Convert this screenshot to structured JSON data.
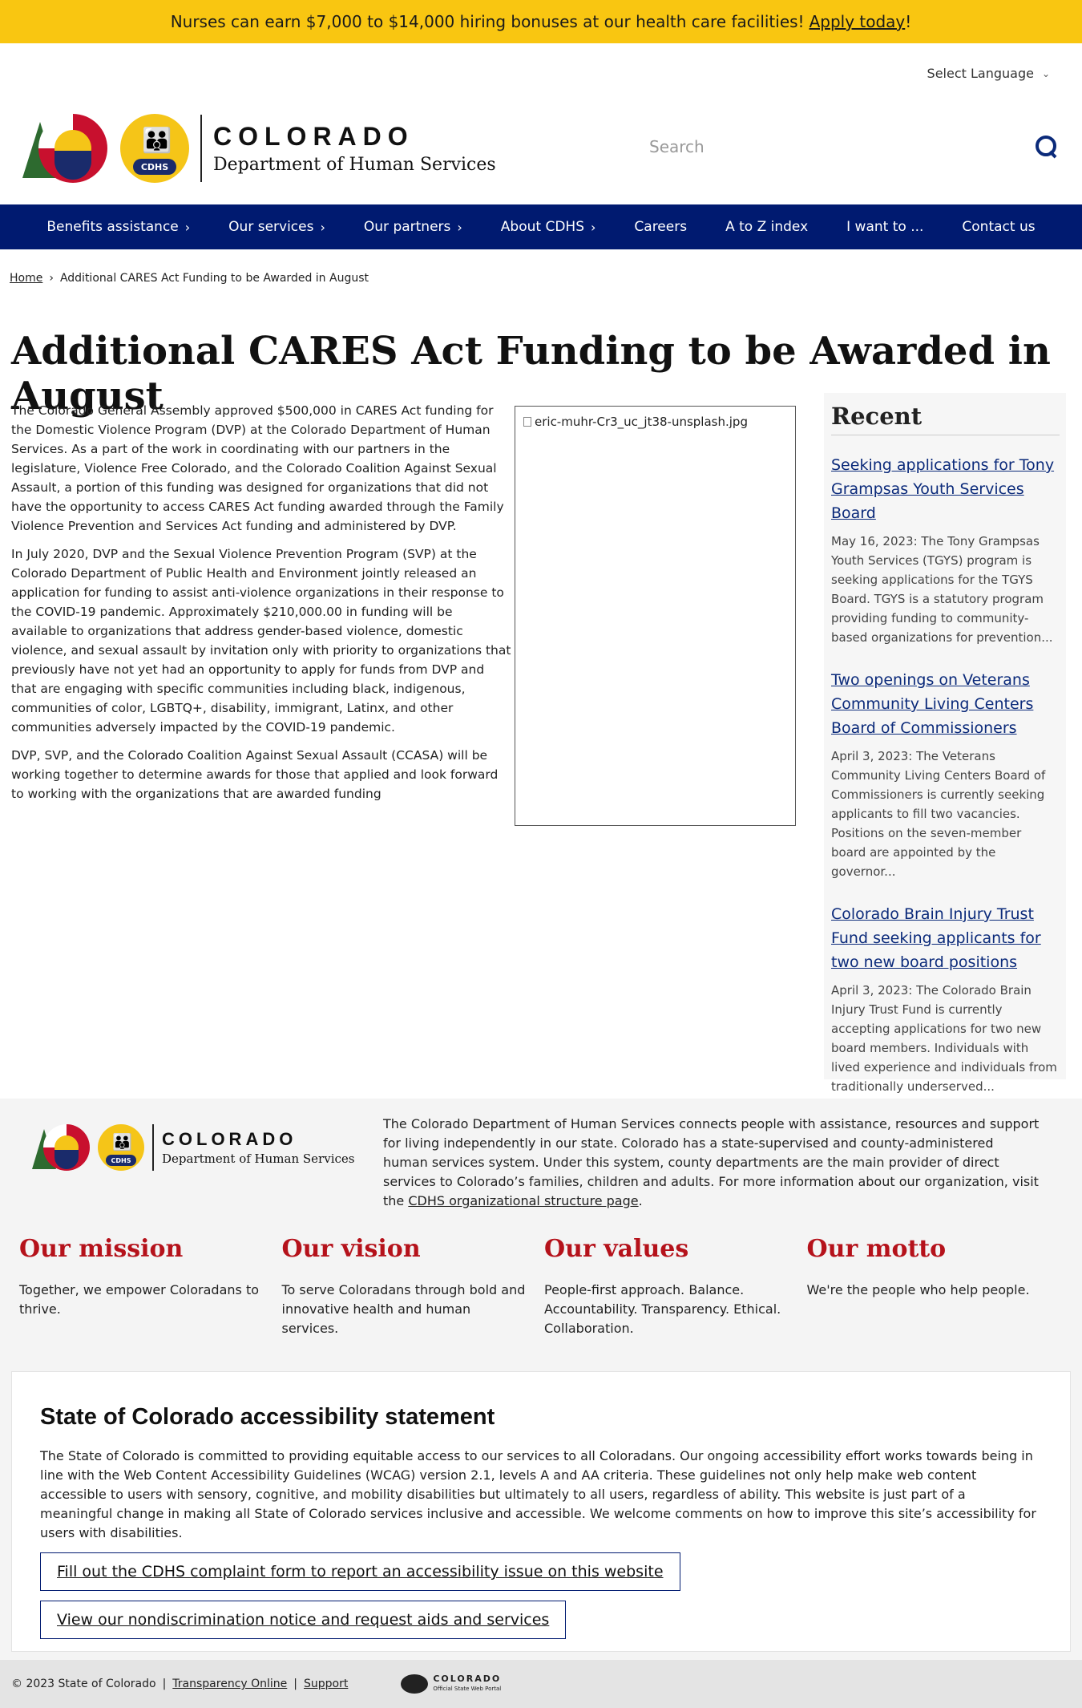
{
  "alert": {
    "text": "Nurses can earn $7,000 to $14,000 hiring bonuses at our health care facilities!",
    "link": "Apply today",
    "suffix": "!"
  },
  "language": {
    "label": "Select Language"
  },
  "logo": {
    "state": "COLORADO",
    "dept": "Department of Human Services",
    "badge": "CDHS"
  },
  "search": {
    "placeholder": "Search"
  },
  "nav": {
    "items": [
      {
        "label": "Benefits assistance",
        "has_menu": true
      },
      {
        "label": "Our services",
        "has_menu": true
      },
      {
        "label": "Our partners",
        "has_menu": true
      },
      {
        "label": "About CDHS",
        "has_menu": true
      },
      {
        "label": "Careers",
        "has_menu": false
      },
      {
        "label": "A to Z index",
        "has_menu": false
      },
      {
        "label": "I want to ...",
        "has_menu": false
      },
      {
        "label": "Contact us",
        "has_menu": false
      }
    ]
  },
  "breadcrumb": {
    "home": "Home",
    "sep": "›",
    "current": "Additional CARES Act Funding to be Awarded in August"
  },
  "page": {
    "title": "Additional CARES Act Funding to be Awarded in August",
    "paragraphs": [
      "The Colorado General Assembly approved $500,000 in CARES Act funding for the Domestic Violence Program (DVP) at the Colorado Department of Human Services. As a part of the work in coordinating with our partners in the legislature, Violence Free Colorado, and the Colorado Coalition Against Sexual Assault, a portion of this funding was designed for organizations that did not have the opportunity to access CARES Act funding awarded through the Family Violence Prevention and Services Act funding and administered by DVP.",
      "In July 2020, DVP and the Sexual Violence Prevention Program (SVP) at the Colorado Department of Public Health and Environment jointly released an application for funding to assist anti-violence organizations in their response to the COVID-19 pandemic. Approximately $210,000.00 in funding will be available to organizations that address gender-based violence, domestic violence, and sexual assault by invitation only with priority to organizations that previously have not yet had an opportunity to apply for funds from DVP and that are engaging with specific communities including black, indigenous, communities of color, LGBTQ+, disability, immigrant, Latinx, and other communities adversely impacted by the COVID-19 pandemic.",
      "DVP, SVP, and the Colorado Coalition Against Sexual Assault (CCASA) will be working together to determine awards for those that applied and look forward to working with the organizations that are awarded funding"
    ],
    "image_alt": "eric-muhr-Cr3_uc_jt38-unsplash.jpg"
  },
  "recent": {
    "heading": "Recent",
    "posts": [
      {
        "title": "Seeking applications for Tony Grampsas Youth Services Board",
        "snippet": "May 16, 2023: The Tony Grampsas Youth Services (TGYS) program is seeking applications for the TGYS Board. TGYS is a statutory program providing funding to community-based organizations for prevention..."
      },
      {
        "title": "Two openings on Veterans Community Living Centers Board of  Commissioners ",
        "snippet": "April 3, 2023: The Veterans Community Living Centers Board of Commissioners is currently seeking applicants to fill two vacancies. Positions on the seven-member board are appointed by the governor..."
      },
      {
        "title": "Colorado Brain Injury Trust Fund seeking applicants for two new board positions",
        "snippet": "April 3, 2023: The Colorado Brain Injury Trust Fund is currently accepting applications for two new board members. Individuals with lived experience and individuals from traditionally underserved..."
      }
    ]
  },
  "footer": {
    "about_text": "The Colorado Department of Human Services connects people with assistance, resources and support for living independently in our state. Colorado has a state-supervised and county-administered human services system. Under this system, county departments are the main provider of direct services to Colorado’s families, children and adults. For more information about our organization, visit the",
    "about_link": "CDHS organizational structure page",
    "about_end": ".",
    "pillars": [
      {
        "title": "Our mission",
        "text": "Together, we empower Coloradans to thrive."
      },
      {
        "title": "Our vision",
        "text": "To serve Coloradans through bold and innovative health and human services."
      },
      {
        "title": "Our values",
        "text": "People-first approach. Balance. Accountability. Transparency. Ethical. Collaboration."
      },
      {
        "title": "Our motto",
        "text": "We're the people who help people."
      }
    ],
    "accessibility": {
      "heading": "State of Colorado accessibility statement",
      "text": "The State of Colorado is committed to providing equitable access to our services to all Coloradans. Our ongoing accessibility effort works towards being in line with the Web Content Accessibility Guidelines (WCAG) version 2.1, levels A and AA criteria. These guidelines not only help make web content accessible to users with sensory, cognitive, and mobility disabilities but ultimately to all users, regardless of ability. This website is just part of a meaningful change in making all State of Colorado services inclusive and accessible. We welcome comments on how to improve this site’s accessibility for users with disabilities.",
      "button1": "Fill out the CDHS complaint form to report an accessibility issue on this website",
      "button2": "View our nondiscrimination notice and request aids and services"
    },
    "bottom": {
      "copyright": "© 2023 State of Colorado",
      "sep": "|",
      "link1": "Transparency Online",
      "link2": "Support",
      "portal_name": "COLORADO",
      "portal_sub": "Official State Web Portal"
    }
  }
}
